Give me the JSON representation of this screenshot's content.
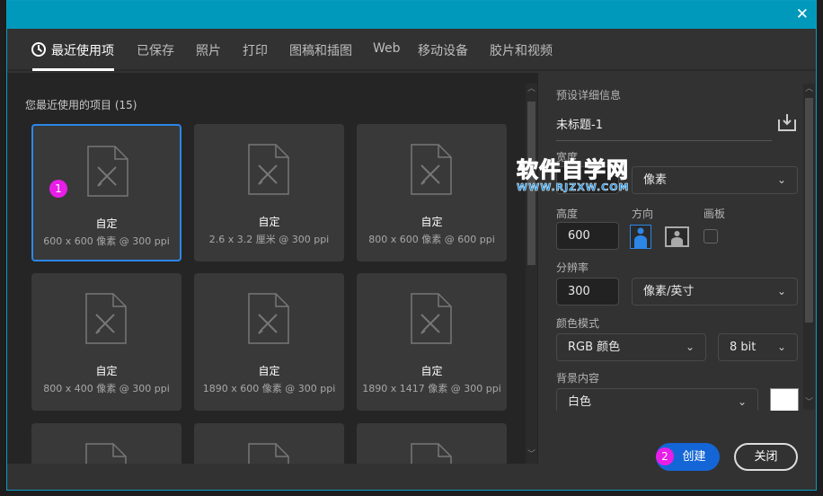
{
  "window": {
    "close_icon": "close-x-icon"
  },
  "tabs": [
    {
      "label": "最近使用项",
      "icon": "clock-icon"
    },
    {
      "label": "已保存"
    },
    {
      "label": "照片"
    },
    {
      "label": "打印"
    },
    {
      "label": "图稿和插图"
    },
    {
      "label": "Web"
    },
    {
      "label": "移动设备"
    },
    {
      "label": "胶片和视频"
    }
  ],
  "recent": {
    "title": "您最近使用的项目",
    "count": "(15)",
    "items": [
      {
        "name": "自定",
        "desc": "600 x 600 像素 @ 300 ppi",
        "selected": true
      },
      {
        "name": "自定",
        "desc": "2.6 x 3.2 厘米 @ 300 ppi"
      },
      {
        "name": "自定",
        "desc": "800 x 600 像素 @ 600 ppi"
      },
      {
        "name": "自定",
        "desc": "800 x 400 像素 @ 300 ppi"
      },
      {
        "name": "自定",
        "desc": "1890 x 600 像素 @ 300 ppi"
      },
      {
        "name": "自定",
        "desc": "1890 x 1417 像素 @ 300 ppi"
      }
    ]
  },
  "details": {
    "title": "预设详细信息",
    "doc_name": "未标题-1",
    "save_icon": "save-preset-icon",
    "width_label": "宽度",
    "width_unit": "像素",
    "height_label": "高度",
    "height_value": "600",
    "orientation_label": "方向",
    "orientation": "portrait",
    "artboard_label": "画板",
    "artboard_checked": false,
    "resolution_label": "分辨率",
    "resolution_value": "300",
    "resolution_unit": "像素/英寸",
    "color_mode_label": "颜色模式",
    "color_mode": "RGB 颜色",
    "bit_depth": "8 bit",
    "background_label": "背景内容",
    "background": "白色",
    "background_swatch": "#ffffff"
  },
  "buttons": {
    "create": "创建",
    "close": "关闭"
  },
  "annotations": {
    "badge1": "1",
    "badge2": "2"
  },
  "watermark": {
    "line1": "软件自学网",
    "line2": "WWW.RJZXW.COM"
  },
  "colors": {
    "accent": "#0099bb",
    "selection": "#2c86e8",
    "create_button": "#1466d6",
    "badge": "#e81ee8"
  }
}
